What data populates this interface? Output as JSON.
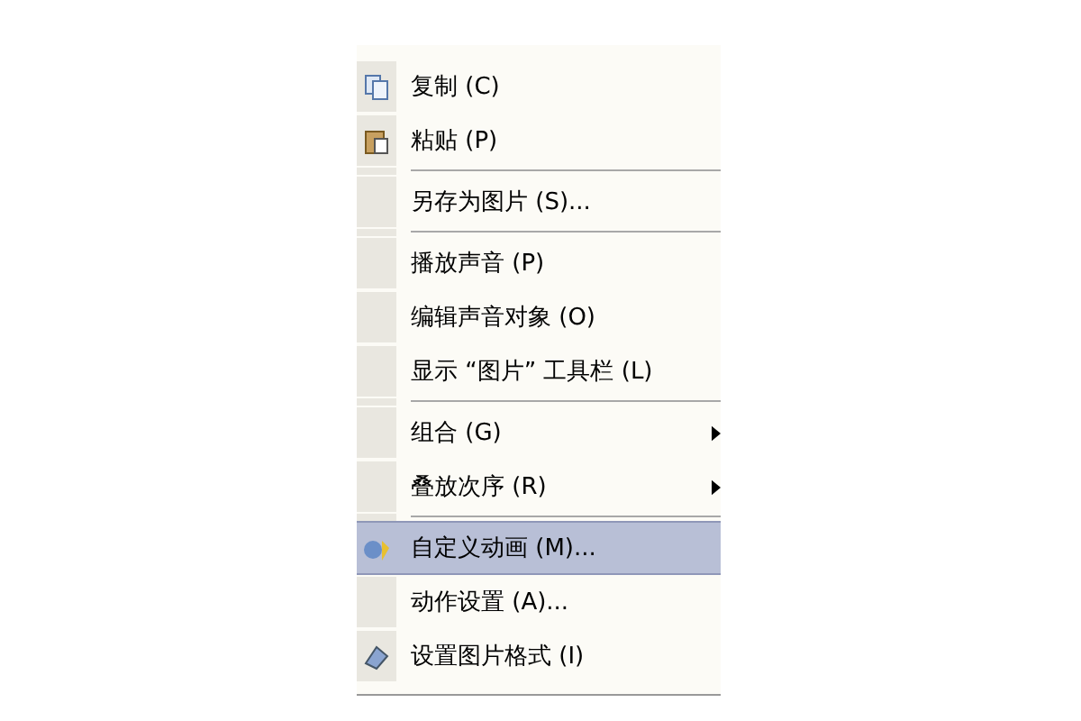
{
  "menu": {
    "items": [
      {
        "kind": "item",
        "label": "复制 (C)",
        "icon": true,
        "submenu": false,
        "selected": false
      },
      {
        "kind": "item",
        "label": "粘贴 (P)",
        "icon": true,
        "submenu": false,
        "selected": false
      },
      {
        "kind": "separator"
      },
      {
        "kind": "item",
        "label": "另存为图片 (S)...",
        "icon": false,
        "submenu": false,
        "selected": false
      },
      {
        "kind": "separator"
      },
      {
        "kind": "item",
        "label": "播放声音 (P)",
        "icon": false,
        "submenu": false,
        "selected": false
      },
      {
        "kind": "item",
        "label": "编辑声音对象 (O)",
        "icon": false,
        "submenu": false,
        "selected": false
      },
      {
        "kind": "item",
        "label": "显示 “图片” 工具栏 (L)",
        "icon": false,
        "submenu": false,
        "selected": false
      },
      {
        "kind": "separator"
      },
      {
        "kind": "item",
        "label": "组合 (G)",
        "icon": false,
        "submenu": true,
        "selected": false
      },
      {
        "kind": "item",
        "label": "叠放次序 (R)",
        "icon": false,
        "submenu": true,
        "selected": false
      },
      {
        "kind": "separator"
      },
      {
        "kind": "item",
        "label": "自定义动画 (M)...",
        "icon": true,
        "submenu": false,
        "selected": true
      },
      {
        "kind": "item",
        "label": "动作设置 (A)...",
        "icon": false,
        "submenu": false,
        "selected": false
      },
      {
        "kind": "item",
        "label": "设置图片格式 (I)",
        "icon": true,
        "submenu": false,
        "selected": false
      }
    ]
  }
}
